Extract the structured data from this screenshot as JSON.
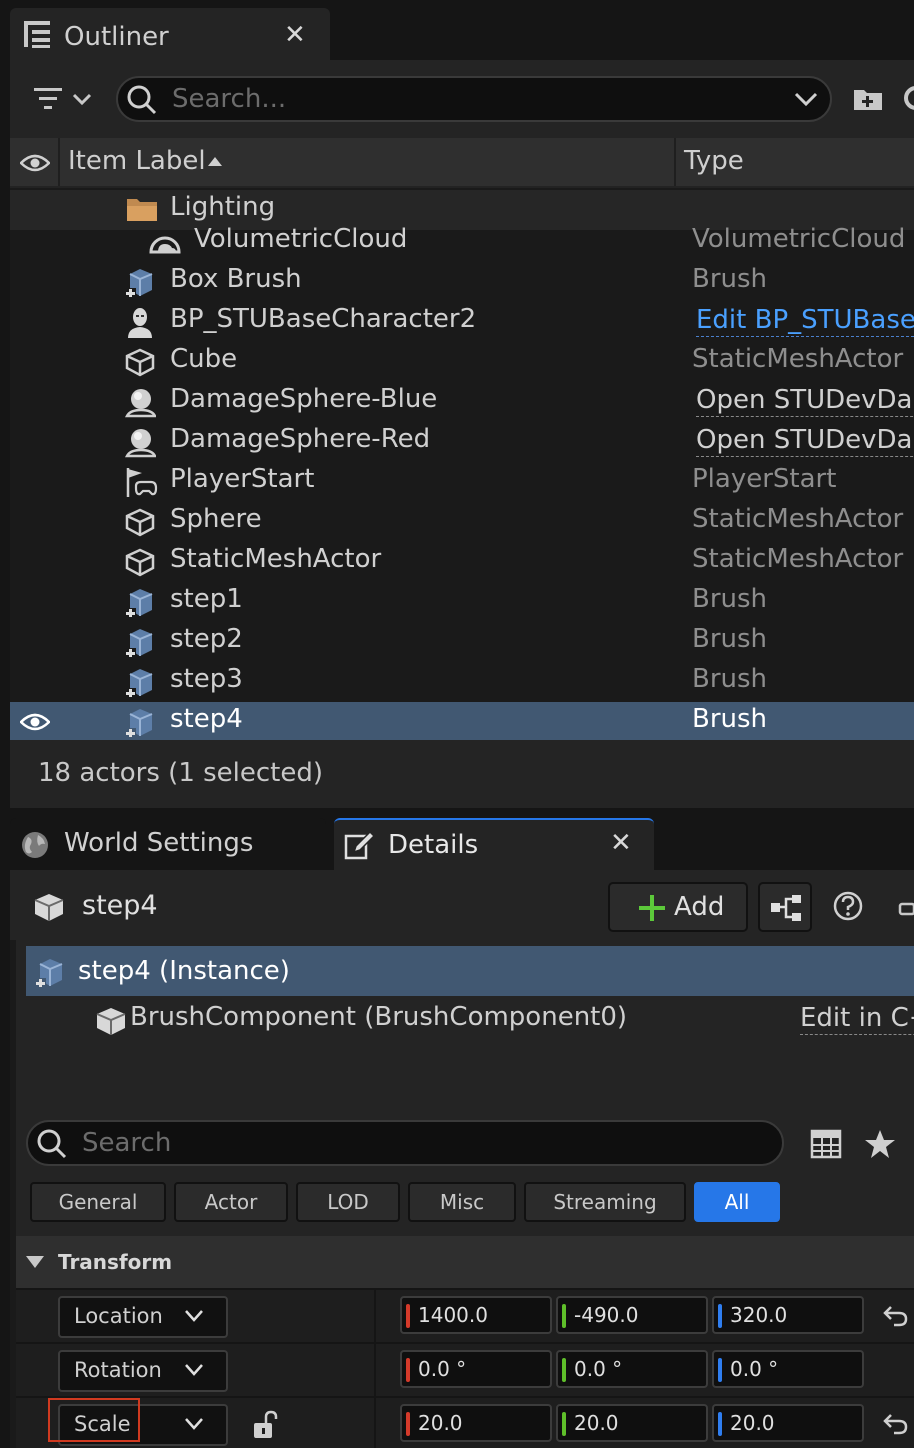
{
  "outliner": {
    "tab_title": "Outliner",
    "close_glyph": "✕",
    "search_placeholder": "Search...",
    "columns": {
      "label": "Item Label",
      "type": "Type"
    },
    "rows": [
      {
        "name": "Lighting",
        "type": "",
        "icon": "folder-icon"
      },
      {
        "name": "VolumetricCloud",
        "type": "VolumetricCloud",
        "icon": "cloud-icon"
      },
      {
        "name": "Box Brush",
        "type": "Brush",
        "icon": "brush-icon"
      },
      {
        "name": "BP_STUBaseCharacter2",
        "type": "Edit BP_STUBaseC",
        "icon": "character-icon"
      },
      {
        "name": "Cube",
        "type": "StaticMeshActor",
        "icon": "static-mesh-icon"
      },
      {
        "name": "DamageSphere-Blue",
        "type": "Open STUDevDam",
        "icon": "actor-icon"
      },
      {
        "name": "DamageSphere-Red",
        "type": "Open STUDevDam",
        "icon": "actor-icon"
      },
      {
        "name": "PlayerStart",
        "type": "PlayerStart",
        "icon": "player-start-icon"
      },
      {
        "name": "Sphere",
        "type": "StaticMeshActor",
        "icon": "static-mesh-icon"
      },
      {
        "name": "StaticMeshActor",
        "type": "StaticMeshActor",
        "icon": "static-mesh-icon"
      },
      {
        "name": "step1",
        "type": "Brush",
        "icon": "brush-icon"
      },
      {
        "name": "step2",
        "type": "Brush",
        "icon": "brush-icon"
      },
      {
        "name": "step3",
        "type": "Brush",
        "icon": "brush-icon"
      },
      {
        "name": "step4",
        "type": "Brush",
        "icon": "brush-icon"
      }
    ],
    "status": "18 actors (1 selected)"
  },
  "details": {
    "tabs": {
      "world_settings": "World Settings",
      "details": "Details"
    },
    "close_glyph": "✕",
    "actor_name": "step4",
    "add_label": "Add",
    "components": {
      "instance": "step4 (Instance)",
      "brush": "BrushComponent (BrushComponent0)",
      "brush_action": "Edit in C+"
    },
    "search_placeholder": "Search",
    "filters": [
      "General",
      "Actor",
      "LOD",
      "Misc",
      "Streaming",
      "All"
    ],
    "category": "Transform",
    "transform": {
      "location": {
        "label": "Location",
        "x": "1400.0",
        "y": "-490.0",
        "z": "320.0"
      },
      "rotation": {
        "label": "Rotation",
        "x": "0.0 °",
        "y": "0.0 °",
        "z": "0.0 °"
      },
      "scale": {
        "label": "Scale",
        "x": "20.0",
        "y": "20.0",
        "z": "20.0"
      }
    }
  },
  "colors": {
    "selection": "#415872",
    "accent_blue": "#2677e8",
    "axis_x": "#d43a2a",
    "axis_y": "#5fbf2a",
    "axis_z": "#2f7ef0"
  }
}
